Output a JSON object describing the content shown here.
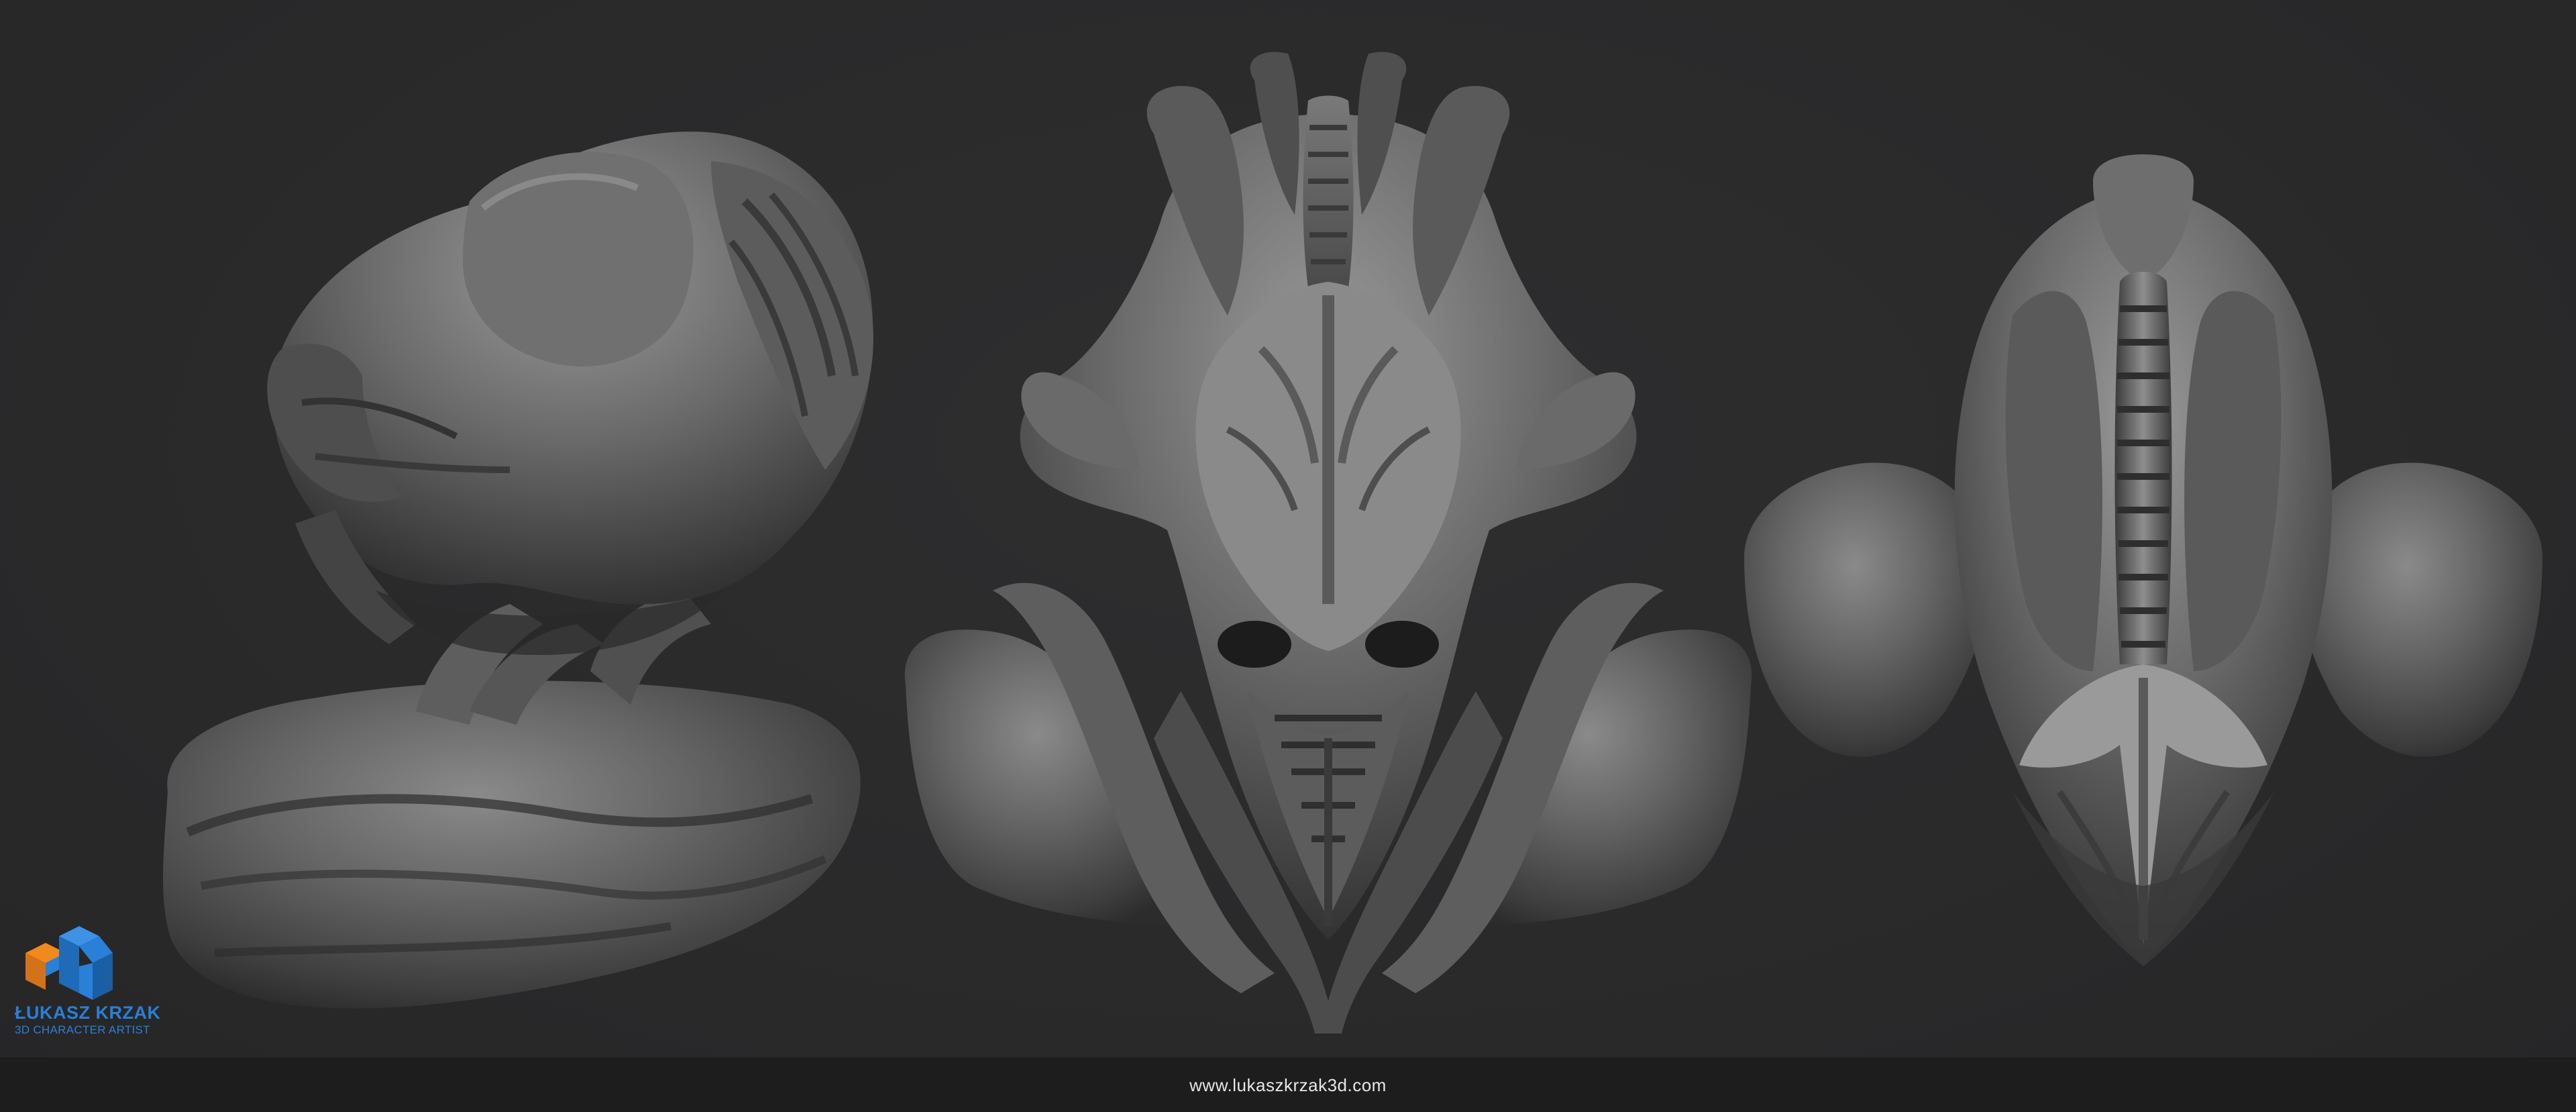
{
  "branding": {
    "name": "ŁUKASZ KRZAK",
    "tagline": "3D CHARACTER ARTIST",
    "logo_colors": {
      "blue": "#2a7fd6",
      "orange": "#f08a1c"
    }
  },
  "footer": {
    "url": "www.lukaszkrzak3d.com"
  },
  "renders": [
    {
      "view": "three-quarter-side",
      "icon": "creature-bust-side"
    },
    {
      "view": "front",
      "icon": "creature-bust-front"
    },
    {
      "view": "top",
      "icon": "creature-bust-top"
    }
  ],
  "colors": {
    "background": "#2a2a2b",
    "footer_background": "#1d1d1e",
    "sculpt_clay": "#6b6b6b"
  }
}
